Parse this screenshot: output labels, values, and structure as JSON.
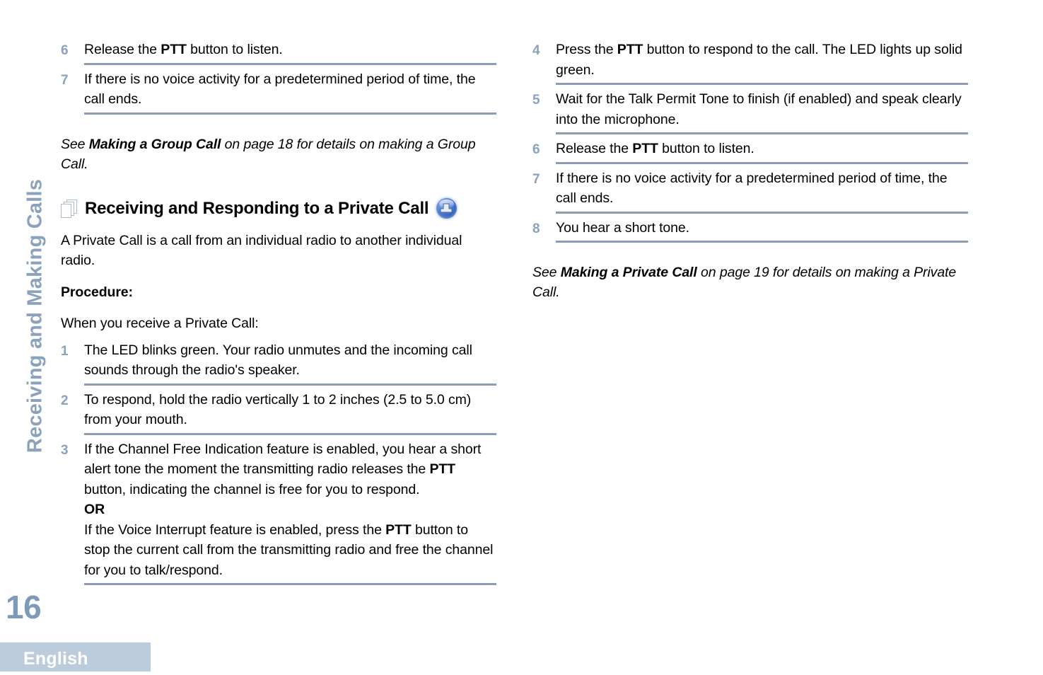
{
  "sidebar": {
    "chapter_title": "Receiving and Making Calls",
    "page_number": "16",
    "language_tab": "English"
  },
  "left_column": {
    "steps_continued": [
      {
        "num": "6",
        "html": "Release the <b>PTT</b> button to listen."
      },
      {
        "num": "7",
        "html": "If there is no voice activity for a predetermined period of time, the call ends."
      }
    ],
    "see_note": "See <b>Making a Group Call</b> on page 18 for details on making a Group Call.",
    "section": {
      "title": "Receiving and Responding to a Private Call",
      "pages_icon": "stacked-pages-icon",
      "pulse_icon": "blue-pulse-circle-icon"
    },
    "intro_paragraph": "A Private Call is a call from an individual radio to another individual radio.",
    "procedure_label": "Procedure:",
    "procedure_lead": "When you receive a Private Call:",
    "steps": [
      {
        "num": "1",
        "html": "The LED blinks green. Your radio unmutes and the incoming call sounds through the radio's speaker."
      },
      {
        "num": "2",
        "html": "To respond, hold the radio vertically 1 to 2 inches (2.5 to 5.0 cm) from your mouth."
      },
      {
        "num": "3",
        "html": "If the Channel Free Indication feature is enabled, you hear a short alert tone the moment the transmitting radio releases the <b>PTT</b> button, indicating the channel is free for you to respond.<br><b>OR</b><br>If the Voice Interrupt feature is enabled, press the <b>PTT</b> button to stop the current call from the transmitting radio and free the channel for you to talk/respond."
      }
    ]
  },
  "right_column": {
    "steps": [
      {
        "num": "4",
        "html": "Press the <b>PTT</b> button to respond to the call. The LED lights up solid green."
      },
      {
        "num": "5",
        "html": "Wait for the Talk Permit Tone to finish (if enabled) and speak clearly into the microphone."
      },
      {
        "num": "6",
        "html": "Release the <b>PTT</b> button to listen."
      },
      {
        "num": "7",
        "html": "If there is no voice activity for a predetermined period of time, the call ends."
      },
      {
        "num": "8",
        "html": "You hear a short tone."
      }
    ],
    "see_note": "See <b>Making a Private Call</b> on page 19 for details on making a Private Call."
  },
  "colors": {
    "accent_blue_gray": "#8ba2bb",
    "rule_line": "#8b9cb3",
    "language_tab_bg": "#bdccdc",
    "page_number": "#7f99b8",
    "icon_blue": "#2a57b5"
  }
}
